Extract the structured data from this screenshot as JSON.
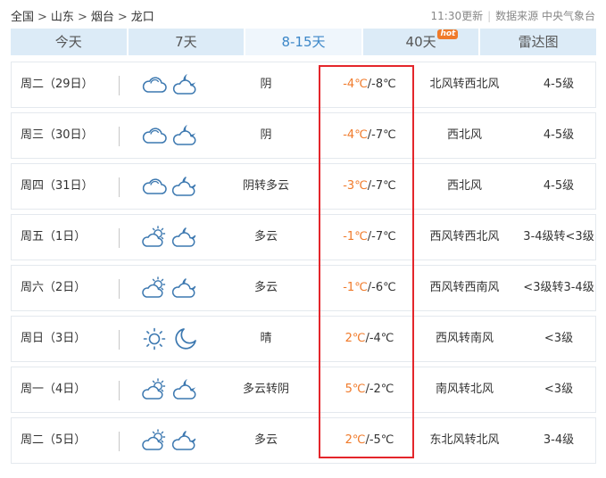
{
  "breadcrumb": {
    "items": [
      "全国",
      "山东",
      "烟台",
      "龙口"
    ],
    "separator": ">"
  },
  "meta": {
    "update": "11:30更新",
    "source": "数据来源 中央气象台"
  },
  "tabs": [
    {
      "label": "今天"
    },
    {
      "label": "7天"
    },
    {
      "label": "8-15天"
    },
    {
      "label": "40天",
      "badge": "hot"
    },
    {
      "label": "雷达图"
    }
  ],
  "colors": {
    "high_temp": "#f07a2a",
    "highlight_box": "#e4262b",
    "tab_active": "#3c87c8"
  },
  "forecast": [
    {
      "date": "周二（29日）",
      "day_icon": "cloudy-icon",
      "night_icon": "cloudy-moon-icon",
      "condition": "阴",
      "high": "-4℃",
      "low": "/-8℃",
      "wind": "北风转西北风",
      "level": "4-5级"
    },
    {
      "date": "周三（30日）",
      "day_icon": "cloudy-icon",
      "night_icon": "cloudy-moon-icon",
      "condition": "阴",
      "high": "-4℃",
      "low": "/-7℃",
      "wind": "西北风",
      "level": "4-5级"
    },
    {
      "date": "周四（31日）",
      "day_icon": "cloudy-icon",
      "night_icon": "partly-cloudy-night-icon",
      "condition": "阴转多云",
      "high": "-3℃",
      "low": "/-7℃",
      "wind": "西北风",
      "level": "4-5级"
    },
    {
      "date": "周五（1日）",
      "day_icon": "partly-cloudy-day-icon",
      "night_icon": "partly-cloudy-night-icon",
      "condition": "多云",
      "high": "-1℃",
      "low": "/-7℃",
      "wind": "西风转西北风",
      "level": "3-4级转<3级"
    },
    {
      "date": "周六（2日）",
      "day_icon": "partly-cloudy-day-icon",
      "night_icon": "partly-cloudy-night-icon",
      "condition": "多云",
      "high": "-1℃",
      "low": "/-6℃",
      "wind": "西风转西南风",
      "level": "<3级转3-4级"
    },
    {
      "date": "周日（3日）",
      "day_icon": "sun-icon",
      "night_icon": "moon-icon",
      "condition": "晴",
      "high": "2℃",
      "low": "/-4℃",
      "wind": "西风转南风",
      "level": "<3级"
    },
    {
      "date": "周一（4日）",
      "day_icon": "partly-cloudy-day-icon",
      "night_icon": "cloudy-moon-icon",
      "condition": "多云转阴",
      "high": "5℃",
      "low": "/-2℃",
      "wind": "南风转北风",
      "level": "<3级"
    },
    {
      "date": "周二（5日）",
      "day_icon": "partly-cloudy-day-icon",
      "night_icon": "partly-cloudy-night-icon",
      "condition": "多云",
      "high": "2℃",
      "low": "/-5℃",
      "wind": "东北风转北风",
      "level": "3-4级"
    }
  ]
}
